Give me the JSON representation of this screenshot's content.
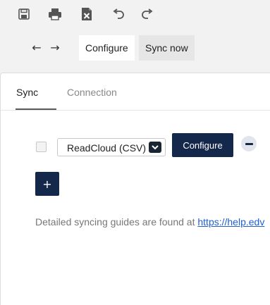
{
  "toolbar": {
    "icons": [
      "save-icon",
      "print-icon",
      "export-excel-icon",
      "undo-icon",
      "redo-icon"
    ]
  },
  "tabs": {
    "back_icon": "←",
    "forward_icon": "→",
    "items": [
      {
        "label": "Configure",
        "active": true
      },
      {
        "label": "Sync now",
        "active": false
      }
    ]
  },
  "subtabs": {
    "items": [
      {
        "label": "Sync",
        "active": true
      },
      {
        "label": "Connection",
        "active": false
      }
    ]
  },
  "sync_row": {
    "selected_source": "ReadCloud (CSV)",
    "configure_label": "Configure"
  },
  "add_button": {
    "label": "+"
  },
  "guide": {
    "text": "Detailed syncing guides are found at ",
    "link_text": "https://help.edv"
  },
  "colors": {
    "primary": "#14284b",
    "link": "#1f5fd1",
    "background": "#f2f2f2"
  }
}
